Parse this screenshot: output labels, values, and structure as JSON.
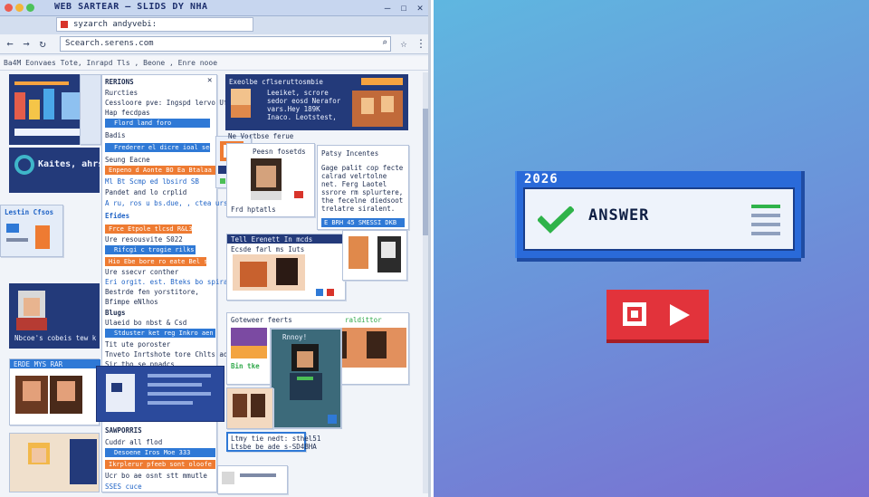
{
  "window": {
    "title": "WEB SARTEAR – SLIDS DY NHA",
    "tab_label": "syzarch andyvebi:",
    "url": "Scearch.serens.com",
    "bookmarks": "Ba4M  Eonvaes Tote,  Inrapd Tls  ,  Beone  ,  Enre nooe"
  },
  "sidebar_panel": {
    "title": "RERIONS",
    "items": [
      "Rurcties",
      "Cessloore pve: Ingspd lervo Ufade",
      "Hap fecdpas",
      "Flord land foro",
      "Badis",
      "Frederer el dicre ioal seep",
      "Seung Eacne",
      "Enpeno d Aonte BO Ea Btalaa",
      "Ml Bt Scmp ed lbsird SB",
      "Pandet and lo crplid",
      "A ru,  ros u bs.due, ,  ctea urst,",
      "Efides",
      "Frce Etpole tlcsd R&L3",
      "Ure resousvite S022",
      "Rifcgi c trogie rilks",
      "Hio Ebe bore ro eate Bel saa",
      "Ure ssecvr conther",
      "Eri orgit. est. Bteks bo spira pretish",
      "Bestrde fen yorstitore,",
      "Bfimpe eNlhos",
      "Blugs",
      "Ulaeid bo nbst & Csd",
      "Stduster ket reg  Inkro aen",
      "Tit ute poroster",
      "Tnveto Inrtshote tore Chlts ada",
      "Sir tho se pnadcs",
      "SAWPORRIS",
      "Cuddr all flod",
      "Desoene Iros Moe 333",
      "Ikrplerur pfeeb sont oloofe",
      "Ucr bo ae osnt stt mmutle",
      "SSES cuce"
    ]
  },
  "cards": {
    "top_banner": "Exeolbe cflseruttosmbie",
    "top_banner_body": "Leeiket, scrore sedor eosd Nerafor vars.Hey 189K Inaco. Leotstest, tered tlcB Il",
    "top_caption": "Ne   Vortbse ferue",
    "profile_title": "Peesn fosetds",
    "profile_caption": "Frd hptatls",
    "patsy_title": "Patsy Incentes",
    "patsy_body": "Gage palit cop fecte calrad velrtolne net. Ferg Laotel ssrore rm splurtere, the fecelne diedsoot trelatre siralent.",
    "patsy_bar": "E BRH 45 SMESSI DKB",
    "mid_title": "Tell Erenett In mcds",
    "mid_sub": "Ecsde farl ms Iuts",
    "left_badge": "Kaites, ahrs mad Enmeteir loun",
    "left_caption": "Lestin Cfsos",
    "lower_caption": "Nbcoe's cobeis tew ked rovels atler",
    "lower_title": "ERDE MYS  RAR",
    "gallery_title": "Goteweer feerts",
    "gallery_tag": "raldittor",
    "gallery_sub": "Rnnoy!",
    "gallery_caption": "Bin tke",
    "footer_text": "Ltsbe be ade s-SD4BHA",
    "footer_top": "Ltmy tie nedt: sthel51"
  },
  "answer_card": {
    "year": "2026",
    "label": "ANSWER"
  },
  "colors": {
    "accent_blue": "#2a6ad9",
    "record_red": "#e2333b",
    "check_green": "#2fb34a"
  },
  "icons": [
    "close-icon",
    "minimize-icon",
    "maximize-icon",
    "back-icon",
    "forward-icon",
    "refresh-icon",
    "search-icon",
    "star-icon",
    "menu-icon",
    "check-icon",
    "stop-icon",
    "play-icon"
  ]
}
